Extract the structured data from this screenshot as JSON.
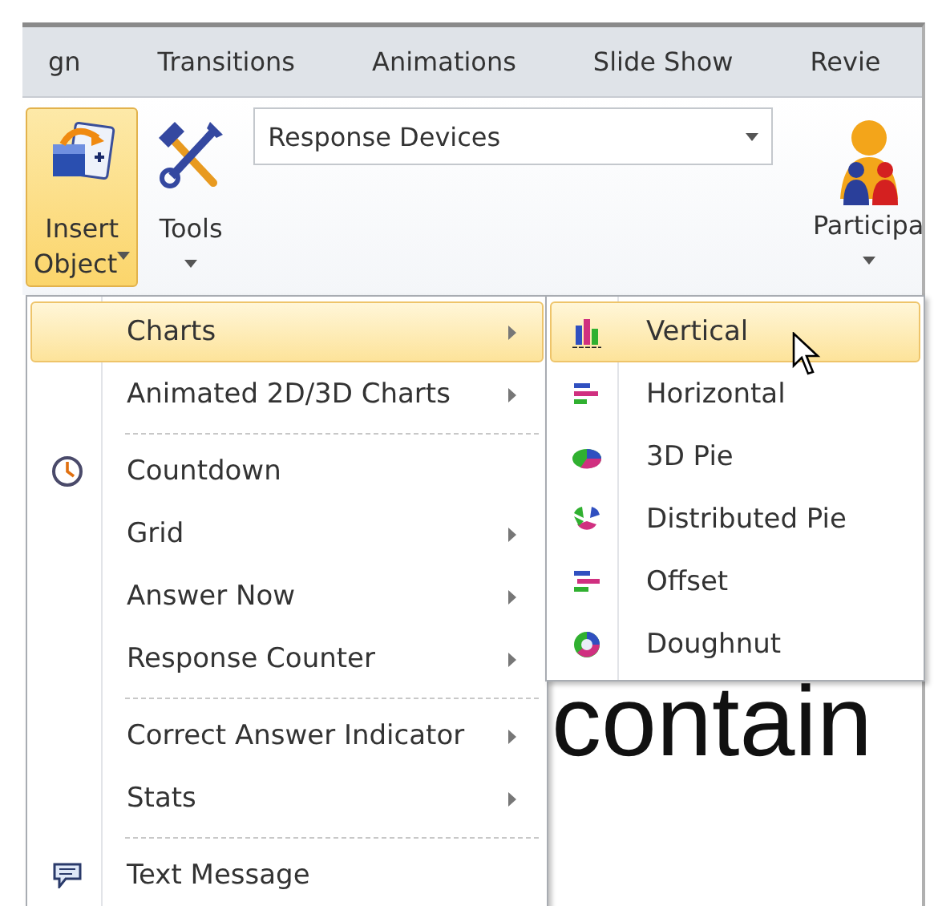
{
  "tabs": [
    {
      "label": "gn",
      "selected": false
    },
    {
      "label": "Transitions",
      "selected": false
    },
    {
      "label": "Animations",
      "selected": false
    },
    {
      "label": "Slide Show",
      "selected": false
    },
    {
      "label": "Revie",
      "selected": false
    }
  ],
  "ribbon": {
    "insert_object": {
      "lines": [
        "Insert",
        "Object"
      ],
      "selected": true
    },
    "tools": {
      "label": "Tools"
    },
    "device_dropdown": {
      "value": "Response Devices"
    },
    "participants": {
      "label": "Participa"
    }
  },
  "slide_text": "contain",
  "menu": [
    {
      "label": "Charts",
      "kind": "plain",
      "submenu": true,
      "separator_before": false,
      "selected": true
    },
    {
      "label": "Animated 2D/3D Charts",
      "kind": "plain",
      "submenu": true,
      "separator_before": false,
      "selected": false
    },
    {
      "label": "Countdown",
      "kind": "timer",
      "submenu": false,
      "separator_before": true,
      "selected": false
    },
    {
      "label": "Grid",
      "kind": "plain",
      "submenu": true,
      "separator_before": false,
      "selected": false
    },
    {
      "label": "Answer Now",
      "kind": "plain",
      "submenu": true,
      "separator_before": false,
      "selected": false
    },
    {
      "label": "Response Counter",
      "kind": "plain",
      "submenu": true,
      "separator_before": false,
      "selected": false
    },
    {
      "label": "Correct Answer Indicator",
      "kind": "plain",
      "submenu": true,
      "separator_before": true,
      "selected": false
    },
    {
      "label": "Stats",
      "kind": "plain",
      "submenu": true,
      "separator_before": false,
      "selected": false
    },
    {
      "label": "Text Message",
      "kind": "message",
      "submenu": false,
      "separator_before": true,
      "selected": false
    }
  ],
  "submenu": [
    {
      "label": "Vertical",
      "kind": "vertical",
      "selected": true
    },
    {
      "label": "Horizontal",
      "kind": "horizontal",
      "selected": false
    },
    {
      "label": "3D Pie",
      "kind": "pie3d",
      "selected": false
    },
    {
      "label": "Distributed Pie",
      "kind": "distributed",
      "selected": false
    },
    {
      "label": "Offset",
      "kind": "offset",
      "selected": false
    },
    {
      "label": "Doughnut",
      "kind": "doughnut",
      "selected": false
    }
  ]
}
